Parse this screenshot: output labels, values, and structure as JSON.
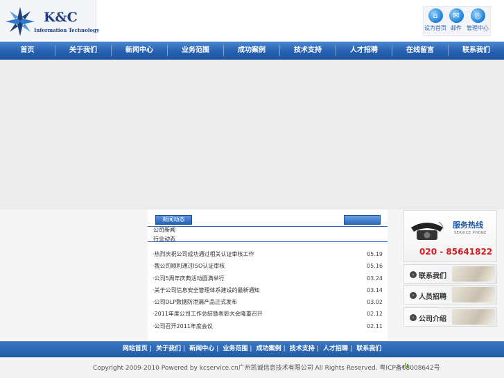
{
  "logo": {
    "main": "K&C",
    "sub": "Information Technology"
  },
  "toplinks": [
    {
      "label": "设为首页",
      "icon": "home-icon",
      "glyph": "⌂"
    },
    {
      "label": "邮件",
      "icon": "mail-icon",
      "glyph": "✉"
    },
    {
      "label": "管理中心",
      "icon": "admin-icon",
      "glyph": "◎"
    }
  ],
  "nav": {
    "items": [
      "首页",
      "关于我们",
      "新闻中心",
      "业务范围",
      "成功案例",
      "技术支持",
      "人才招聘",
      "在线留言",
      "联系我们"
    ]
  },
  "news": {
    "tab_label": "新闻动态",
    "sub1": "公司新闻",
    "sub2": "行业动态",
    "items": [
      {
        "title": "热烈庆祝公司成功通过相关认证审核工作",
        "date": "05.19"
      },
      {
        "title": "我公司顺利通过ISO认证审核",
        "date": "05.16"
      },
      {
        "title": "公司5周年庆典活动圆满举行",
        "date": "03.24"
      },
      {
        "title": "关于公司信息安全管理体系建设的最新通知",
        "date": "03.14"
      },
      {
        "title": "公司DLP数据防泄漏产品正式发布",
        "date": "03.02"
      },
      {
        "title": "2011年度公司工作总结暨表彰大会隆重召开",
        "date": "02.12"
      },
      {
        "title": "公司召开2011年度会议",
        "date": "02.11"
      }
    ]
  },
  "side": {
    "hotline_title": "服务热线",
    "hotline_sub": "SERVICE PHONE",
    "hotline_number": "020 - 85641822",
    "buttons": [
      "联系我们",
      "人员招聘",
      "公司介绍"
    ]
  },
  "footer": {
    "links": [
      "网站首页",
      "关于我们",
      "新闻中心",
      "业务范围",
      "成功案例",
      "技术支持",
      "人才招聘",
      "联系我们"
    ],
    "copyright": "Copyright 2009-2010 Powered by kcservice.cn广州凯诚信息技术有限公司 All Rights Reserved. 粤ICP备08008642号"
  }
}
